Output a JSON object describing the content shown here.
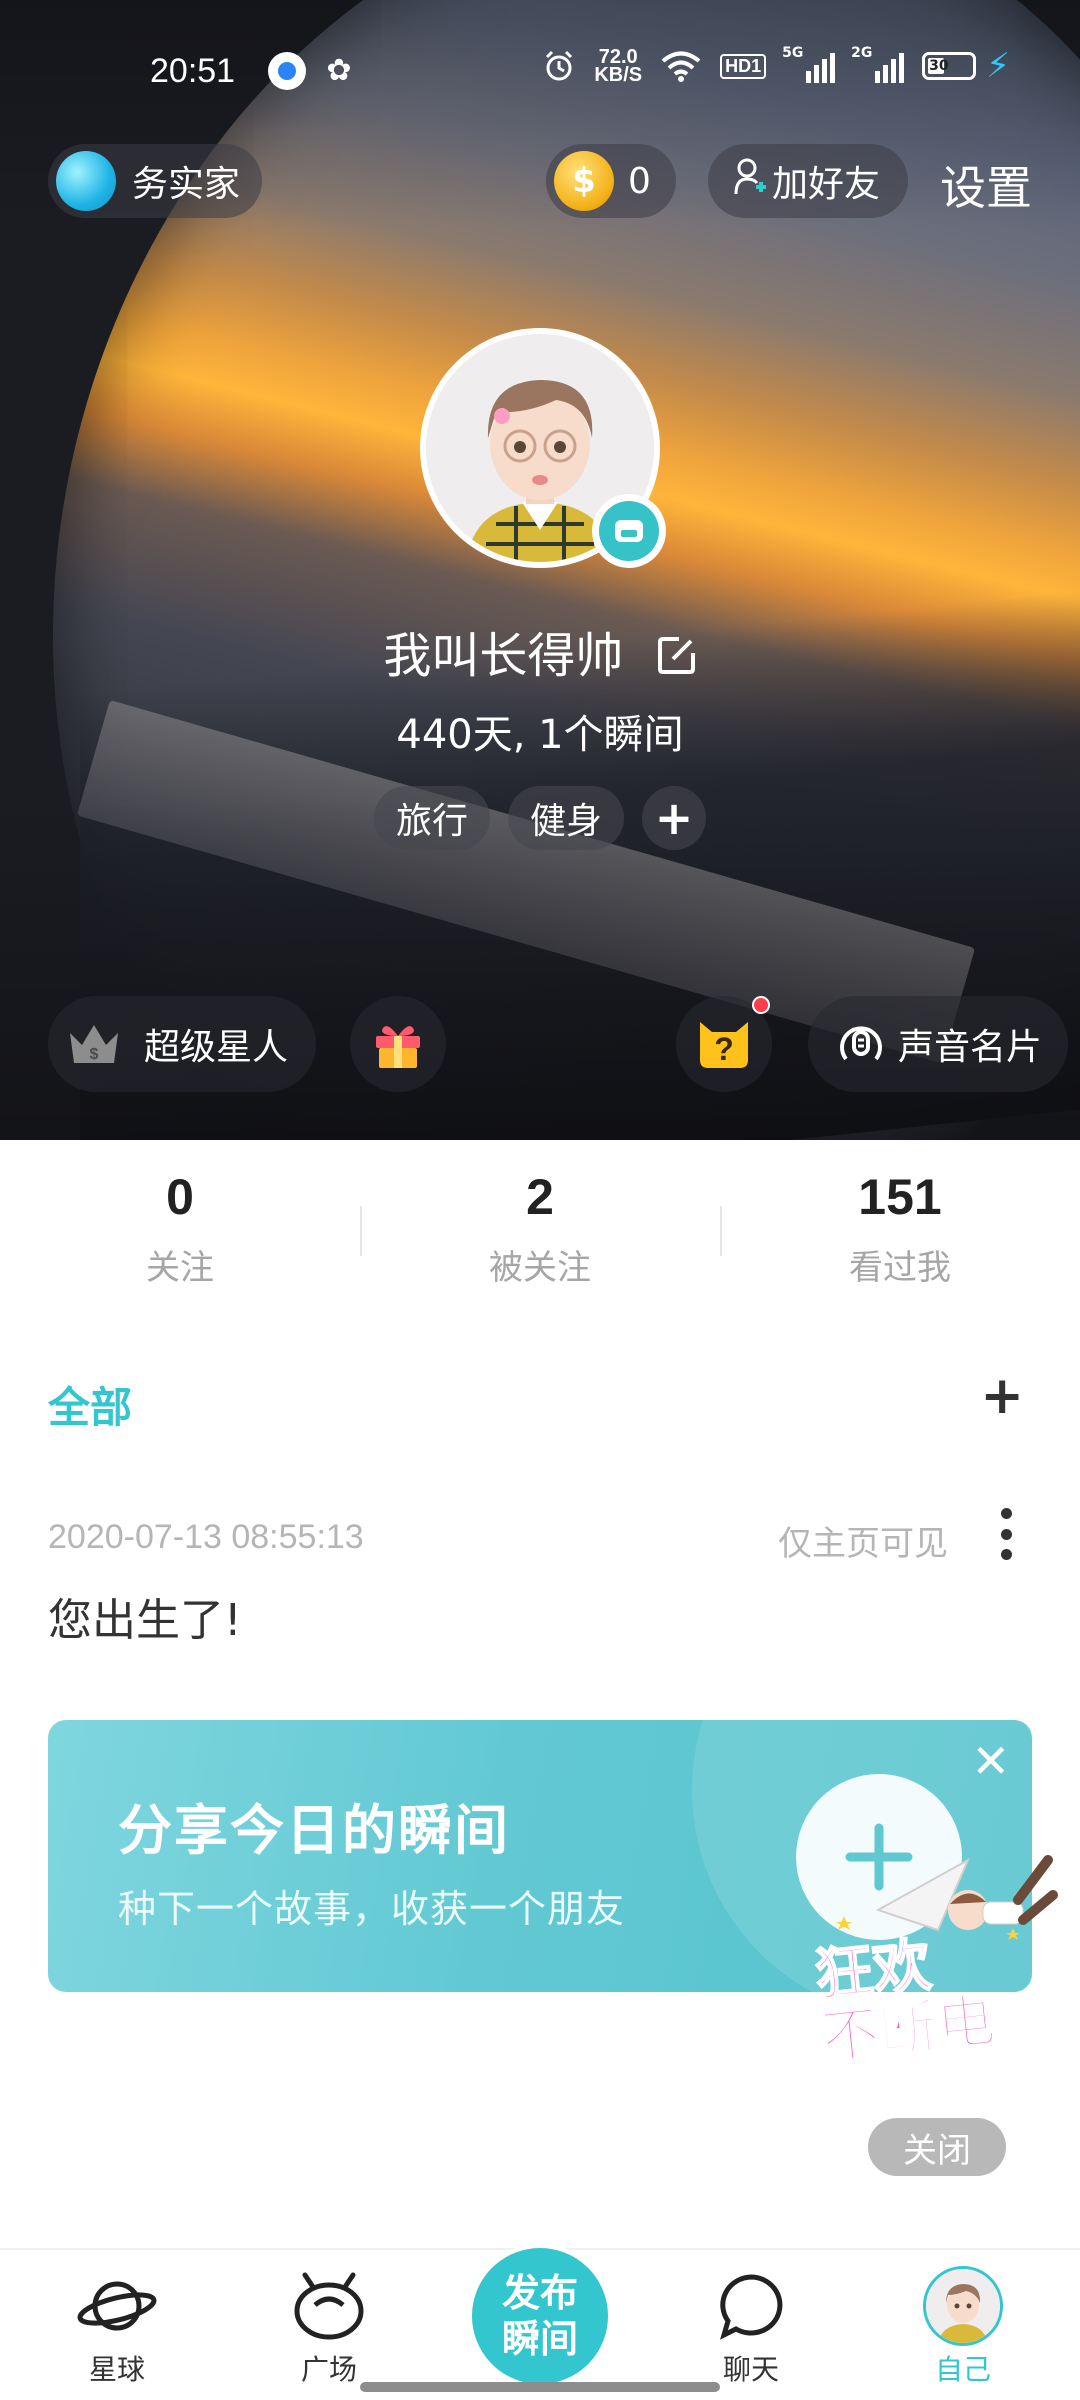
{
  "status_bar": {
    "time": "20:51",
    "net_speed_value": "72.0",
    "net_speed_unit": "KB/S",
    "hd_label": "HD1",
    "signal1_label": "5G",
    "signal2_label": "2G",
    "battery_label": "30",
    "icons": [
      "notification-app-icon",
      "squirrel-app-icon",
      "alarm-icon",
      "wifi-icon",
      "signal-icon",
      "battery-icon",
      "charging-icon"
    ]
  },
  "header": {
    "planet_label": "务实家",
    "coin_count": "0",
    "add_friend_label": "加好友",
    "settings_label": "设置"
  },
  "profile": {
    "nickname": "我叫长得帅",
    "stats_line": "440天, 1个瞬间",
    "tags": [
      "旅行",
      "健身"
    ],
    "add_tag_label": "+"
  },
  "hero_actions": {
    "vip_label": "超级星人",
    "voice_card_label": "声音名片"
  },
  "follow_stats": [
    {
      "value": "0",
      "label": "关注"
    },
    {
      "value": "2",
      "label": "被关注"
    },
    {
      "value": "151",
      "label": "看过我"
    }
  ],
  "feed": {
    "tab_label": "全部",
    "add_label": "+",
    "post": {
      "time": "2020-07-13 08:55:13",
      "visibility": "仅主页可见",
      "text": "您出生了!"
    }
  },
  "share_card": {
    "title": "分享今日的瞬间",
    "subtitle": "种下一个故事，收获一个朋友"
  },
  "promo": {
    "text_line1": "狂欢",
    "text_line2": "不断电",
    "close_label": "关闭"
  },
  "bottom_nav": {
    "items": [
      {
        "label": "星球",
        "icon": "planet-icon"
      },
      {
        "label": "广场",
        "icon": "square-icon"
      },
      {
        "label": "聊天",
        "icon": "chat-icon"
      },
      {
        "label": "自己",
        "icon": "me-avatar-icon"
      }
    ],
    "publish_line1": "发布",
    "publish_line2": "瞬间"
  },
  "colors": {
    "accent": "#33c6cf",
    "coin": "#f5b21a",
    "notification_dot": "#ff3c4c",
    "promo": "#ff5ec0"
  }
}
